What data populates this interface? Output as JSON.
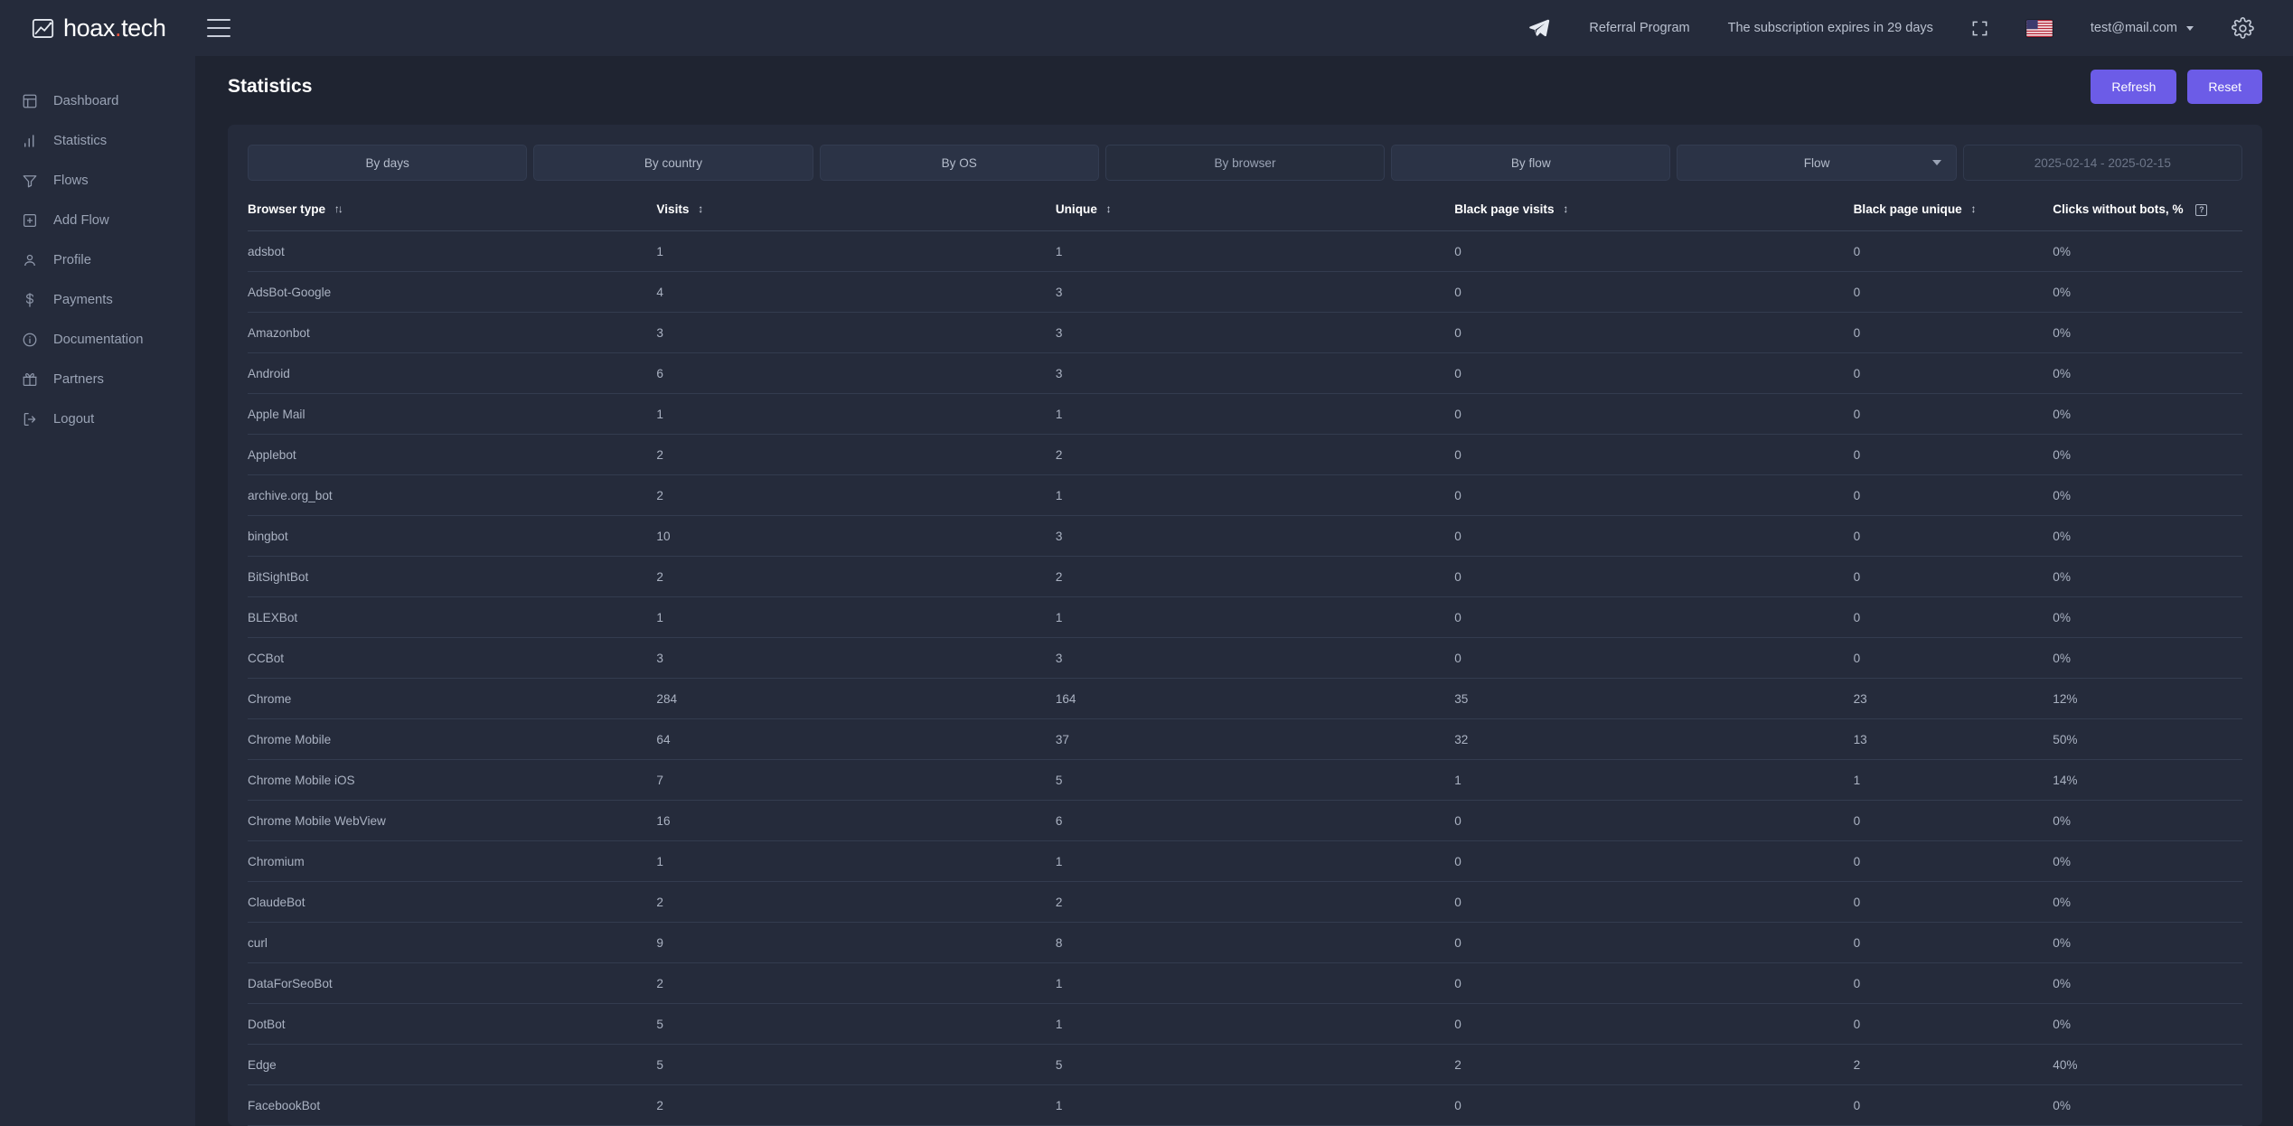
{
  "brand": {
    "name": "hoax",
    "dot": ".",
    "suffix": "tech",
    "logo_icon": "chart-image-logo-icon"
  },
  "topbar": {
    "menu_icon": "hamburger-menu-icon",
    "telegram_icon": "telegram-send-icon",
    "referral_label": "Referral Program",
    "subscription_label": "The subscription expires in 29 days",
    "fullscreen_icon": "fullscreen-expand-icon",
    "flag_icon": "us-flag-icon",
    "account_email": "test@mail.com",
    "account_caret_icon": "chevron-down-icon",
    "settings_icon": "gear-icon"
  },
  "sidebar": {
    "items": [
      {
        "label": "Dashboard",
        "icon": "dashboard-layout-icon"
      },
      {
        "label": "Statistics",
        "icon": "bar-chart-icon"
      },
      {
        "label": "Flows",
        "icon": "funnel-filter-icon"
      },
      {
        "label": "Add Flow",
        "icon": "plus-square-icon"
      },
      {
        "label": "Profile",
        "icon": "user-person-icon"
      },
      {
        "label": "Payments",
        "icon": "dollar-sign-icon"
      },
      {
        "label": "Documentation",
        "icon": "info-circle-icon"
      },
      {
        "label": "Partners",
        "icon": "gift-box-icon"
      },
      {
        "label": "Logout",
        "icon": "logout-arrow-icon"
      }
    ]
  },
  "page": {
    "title": "Statistics",
    "refresh_label": "Refresh",
    "reset_label": "Reset"
  },
  "filters": {
    "tabs": [
      {
        "label": "By days",
        "active": false
      },
      {
        "label": "By country",
        "active": false
      },
      {
        "label": "By OS",
        "active": false
      },
      {
        "label": "By browser",
        "active": true
      },
      {
        "label": "By flow",
        "active": false
      }
    ],
    "flow_select": {
      "label": "Flow",
      "caret_icon": "caret-down-icon"
    },
    "date_range": {
      "value": "2025-02-14 - 2025-02-15"
    }
  },
  "table": {
    "columns": [
      {
        "label": "Browser type",
        "sort": "↑↓",
        "help": false
      },
      {
        "label": "Visits",
        "sort": "↕",
        "help": false
      },
      {
        "label": "Unique",
        "sort": "↕",
        "help": false
      },
      {
        "label": "Black page visits",
        "sort": "↕",
        "help": false
      },
      {
        "label": "Black page unique",
        "sort": "↕",
        "help": false
      },
      {
        "label": "Clicks without bots, %",
        "sort": "",
        "help": true
      }
    ],
    "rows": [
      {
        "browser": "adsbot",
        "visits": "1",
        "unique": "1",
        "black_visits": "0",
        "black_unique": "0",
        "clicks": "0%"
      },
      {
        "browser": "AdsBot-Google",
        "visits": "4",
        "unique": "3",
        "black_visits": "0",
        "black_unique": "0",
        "clicks": "0%"
      },
      {
        "browser": "Amazonbot",
        "visits": "3",
        "unique": "3",
        "black_visits": "0",
        "black_unique": "0",
        "clicks": "0%"
      },
      {
        "browser": "Android",
        "visits": "6",
        "unique": "3",
        "black_visits": "0",
        "black_unique": "0",
        "clicks": "0%"
      },
      {
        "browser": "Apple Mail",
        "visits": "1",
        "unique": "1",
        "black_visits": "0",
        "black_unique": "0",
        "clicks": "0%"
      },
      {
        "browser": "Applebot",
        "visits": "2",
        "unique": "2",
        "black_visits": "0",
        "black_unique": "0",
        "clicks": "0%"
      },
      {
        "browser": "archive.org_bot",
        "visits": "2",
        "unique": "1",
        "black_visits": "0",
        "black_unique": "0",
        "clicks": "0%"
      },
      {
        "browser": "bingbot",
        "visits": "10",
        "unique": "3",
        "black_visits": "0",
        "black_unique": "0",
        "clicks": "0%"
      },
      {
        "browser": "BitSightBot",
        "visits": "2",
        "unique": "2",
        "black_visits": "0",
        "black_unique": "0",
        "clicks": "0%"
      },
      {
        "browser": "BLEXBot",
        "visits": "1",
        "unique": "1",
        "black_visits": "0",
        "black_unique": "0",
        "clicks": "0%"
      },
      {
        "browser": "CCBot",
        "visits": "3",
        "unique": "3",
        "black_visits": "0",
        "black_unique": "0",
        "clicks": "0%"
      },
      {
        "browser": "Chrome",
        "visits": "284",
        "unique": "164",
        "black_visits": "35",
        "black_unique": "23",
        "clicks": "12%"
      },
      {
        "browser": "Chrome Mobile",
        "visits": "64",
        "unique": "37",
        "black_visits": "32",
        "black_unique": "13",
        "clicks": "50%"
      },
      {
        "browser": "Chrome Mobile iOS",
        "visits": "7",
        "unique": "5",
        "black_visits": "1",
        "black_unique": "1",
        "clicks": "14%"
      },
      {
        "browser": "Chrome Mobile WebView",
        "visits": "16",
        "unique": "6",
        "black_visits": "0",
        "black_unique": "0",
        "clicks": "0%"
      },
      {
        "browser": "Chromium",
        "visits": "1",
        "unique": "1",
        "black_visits": "0",
        "black_unique": "0",
        "clicks": "0%"
      },
      {
        "browser": "ClaudeBot",
        "visits": "2",
        "unique": "2",
        "black_visits": "0",
        "black_unique": "0",
        "clicks": "0%"
      },
      {
        "browser": "curl",
        "visits": "9",
        "unique": "8",
        "black_visits": "0",
        "black_unique": "0",
        "clicks": "0%"
      },
      {
        "browser": "DataForSeoBot",
        "visits": "2",
        "unique": "1",
        "black_visits": "0",
        "black_unique": "0",
        "clicks": "0%"
      },
      {
        "browser": "DotBot",
        "visits": "5",
        "unique": "1",
        "black_visits": "0",
        "black_unique": "0",
        "clicks": "0%"
      },
      {
        "browser": "Edge",
        "visits": "5",
        "unique": "5",
        "black_visits": "2",
        "black_unique": "2",
        "clicks": "40%"
      },
      {
        "browser": "FacebookBot",
        "visits": "2",
        "unique": "1",
        "black_visits": "0",
        "black_unique": "0",
        "clicks": "0%"
      }
    ]
  },
  "colors": {
    "accent": "#6c5ce7",
    "panel": "#252b3b",
    "background": "#1f2431",
    "brand_dot": "#e8513c"
  }
}
